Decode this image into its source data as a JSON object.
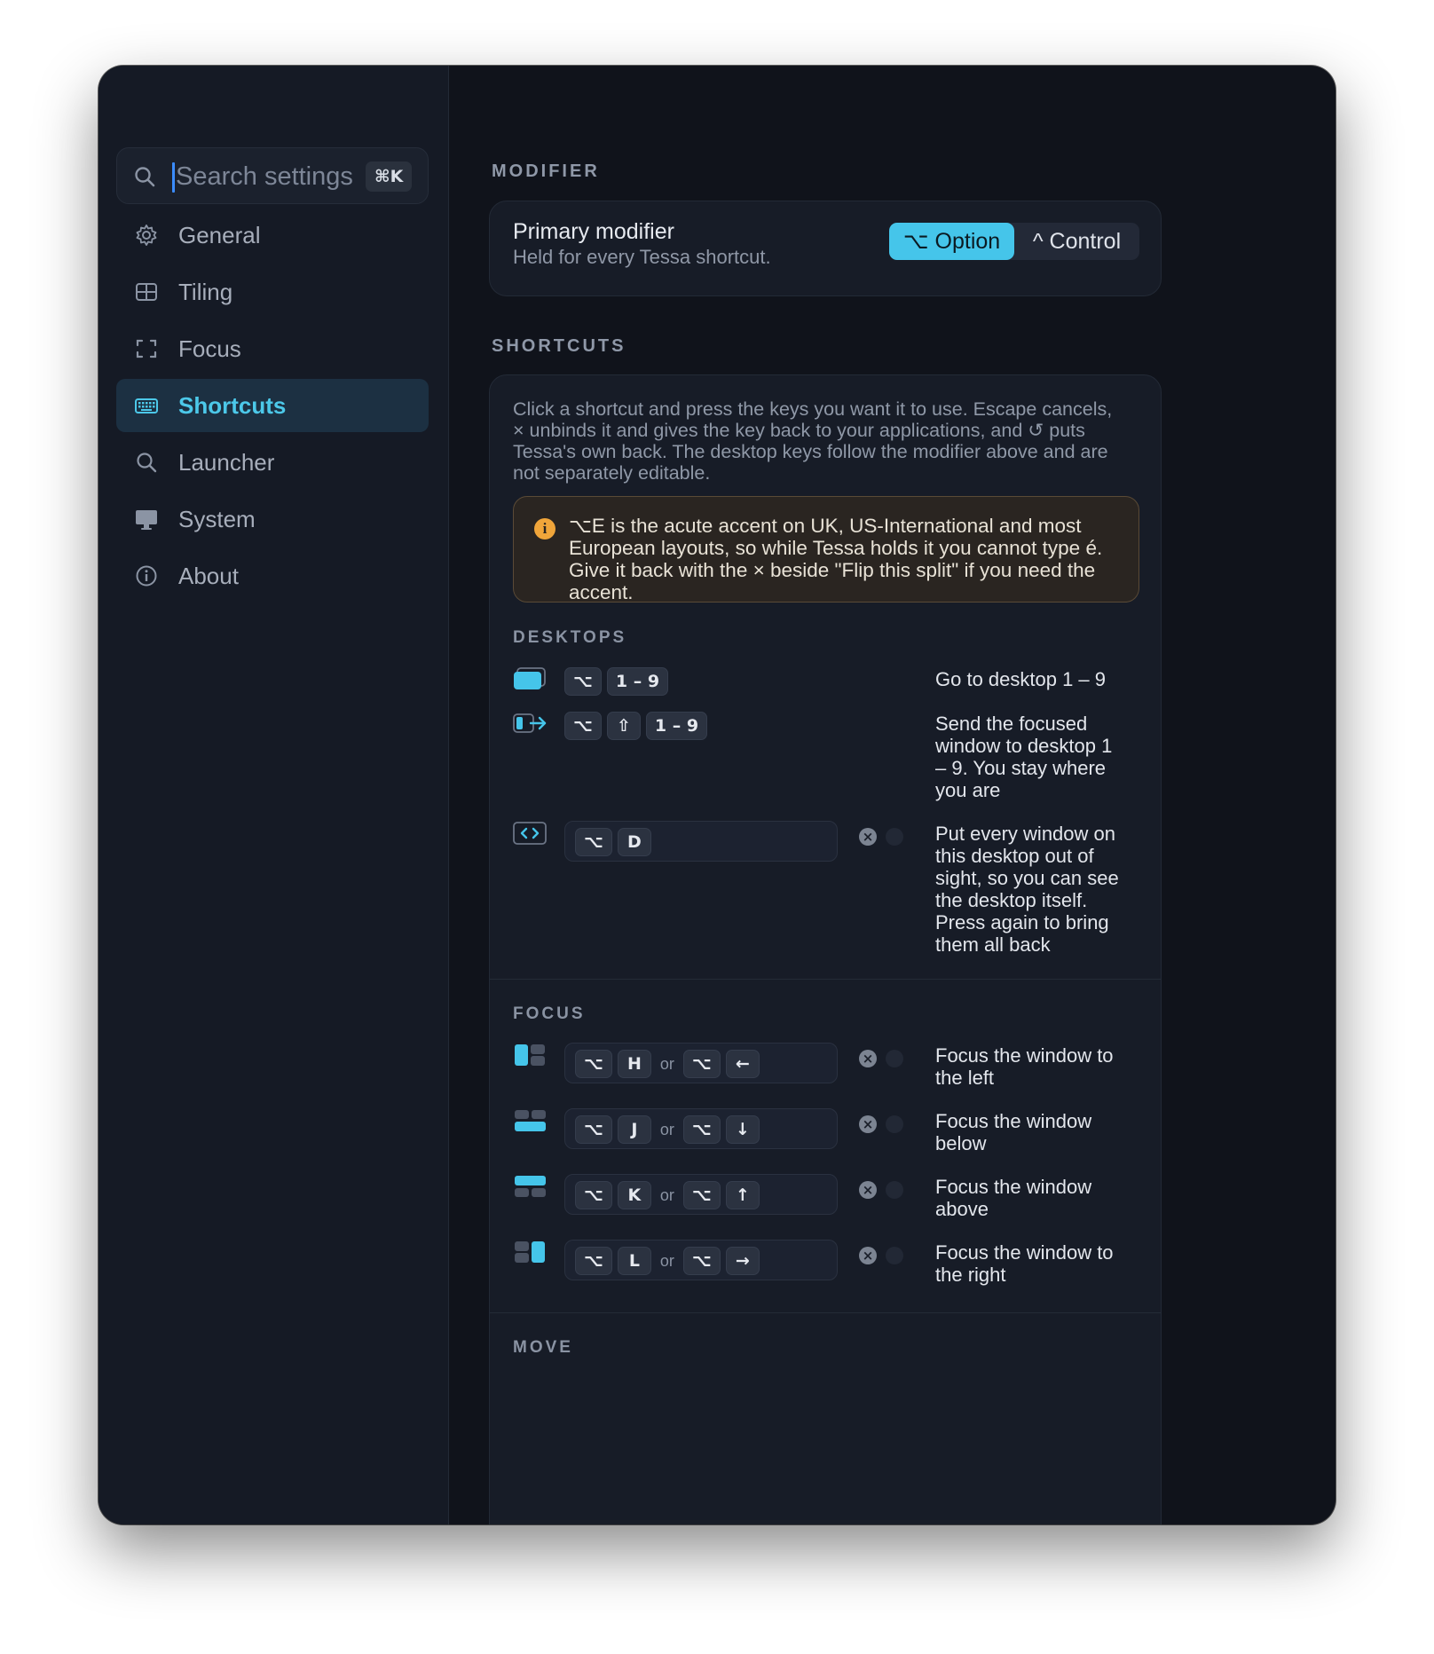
{
  "sidebar": {
    "search": {
      "placeholder": "Search settings",
      "shortcut": "⌘K"
    },
    "items": [
      {
        "label": "General",
        "icon": "gear-icon"
      },
      {
        "label": "Tiling",
        "icon": "grid-icon"
      },
      {
        "label": "Focus",
        "icon": "focus-frame-icon"
      },
      {
        "label": "Shortcuts",
        "icon": "keyboard-icon",
        "active": true
      },
      {
        "label": "Launcher",
        "icon": "search-icon"
      },
      {
        "label": "System",
        "icon": "monitor-icon"
      },
      {
        "label": "About",
        "icon": "info-icon"
      }
    ]
  },
  "modifier": {
    "header": "MODIFIER",
    "title": "Primary modifier",
    "subtitle": "Held for every Tessa shortcut.",
    "options": [
      "⌥ Option",
      "^ Control"
    ],
    "selected": "⌥ Option"
  },
  "shortcuts": {
    "header": "SHORTCUTS",
    "description": "Click a shortcut and press the keys you want it to use. Escape cancels, × unbinds it and gives the key back to your applications, and ↺ puts Tessa's own back. The desktop keys follow the modifier above and are not separately editable.",
    "warning": "⌥E is the acute accent on UK, US-International and most European layouts, so while Tessa holds it you cannot type é. Give it back with the × beside \"Flip this split\" if you need the accent.",
    "desktops": {
      "header": "DESKTOPS",
      "rows": [
        {
          "keys": [
            "⌥",
            "1 – 9"
          ],
          "desc": "Go to desktop 1 – 9",
          "icon": "desktop-icon"
        },
        {
          "keys": [
            "⌥",
            "⇧",
            "1 – 9"
          ],
          "desc": "Send the focused window to desktop 1 – 9. You stay where you are",
          "icon": "send-to-desktop-icon"
        },
        {
          "keys": [
            "⌥",
            "D"
          ],
          "desc": "Put every window on this desktop out of sight, so you can see the desktop itself. Press again to bring them all back",
          "icon": "show-desktop-icon"
        }
      ]
    },
    "focus": {
      "header": "FOCUS",
      "or_label": "or",
      "rows": [
        {
          "keys": [
            "⌥",
            "H"
          ],
          "alt_keys": [
            "⌥",
            "←"
          ],
          "desc": "Focus the window to the left",
          "icon": "focus-left-icon"
        },
        {
          "keys": [
            "⌥",
            "J"
          ],
          "alt_keys": [
            "⌥",
            "↓"
          ],
          "desc": "Focus the window below",
          "icon": "focus-down-icon"
        },
        {
          "keys": [
            "⌥",
            "K"
          ],
          "alt_keys": [
            "⌥",
            "↑"
          ],
          "desc": "Focus the window above",
          "icon": "focus-up-icon"
        },
        {
          "keys": [
            "⌥",
            "L"
          ],
          "alt_keys": [
            "⌥",
            "→"
          ],
          "desc": "Focus the window to the right",
          "icon": "focus-right-icon"
        }
      ]
    },
    "move": {
      "header": "MOVE"
    }
  },
  "colors": {
    "accent": "#45c5ea",
    "background": "#10131b",
    "sidebar": "#151a25",
    "warning": "#f0a53a"
  }
}
